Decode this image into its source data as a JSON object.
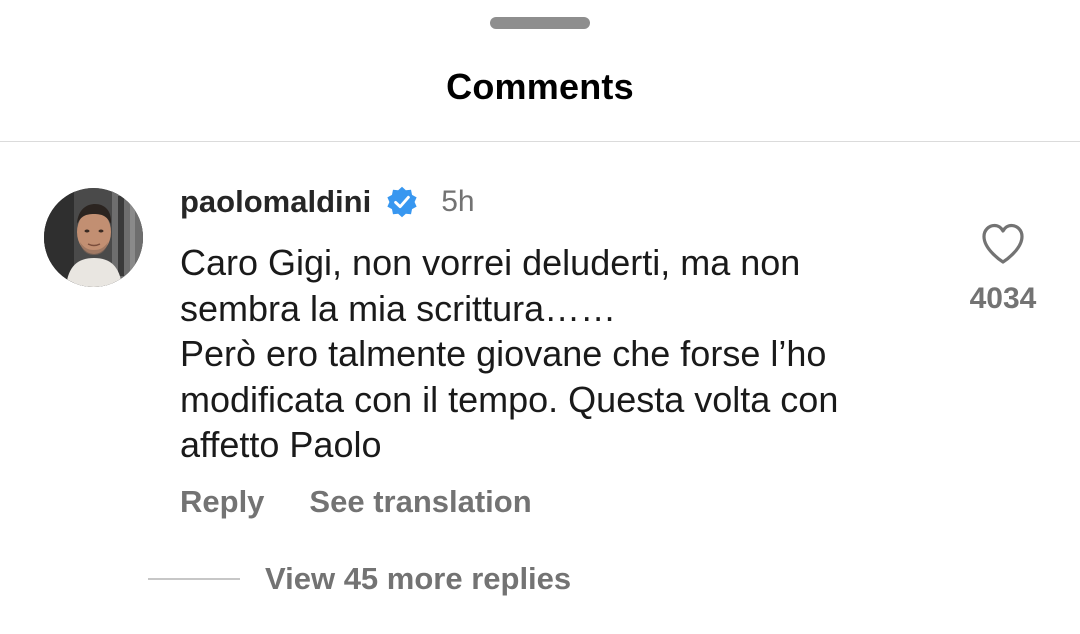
{
  "sheet": {
    "title": "Comments",
    "grabber_icon": "drag-handle-icon"
  },
  "comment": {
    "username": "paolomaldini",
    "verified_icon": "verified-badge-icon",
    "verified_color": "#3897f0",
    "time": "5h",
    "text": "Caro Gigi, non vorrei deluderti, ma non\nsembra la mia scrittura……\nPerò ero talmente giovane che forse l’ho\nmodificata con il tempo. Questa volta con\naffetto  Paolo",
    "reply_label": "Reply",
    "translate_label": "See translation",
    "like_icon": "heart-outline-icon",
    "like_count": "4034",
    "view_replies_label": "View 45 more replies"
  },
  "colors": {
    "secondary_text": "#737373",
    "divider": "#dbdbdb",
    "primary_text": "#262626"
  }
}
